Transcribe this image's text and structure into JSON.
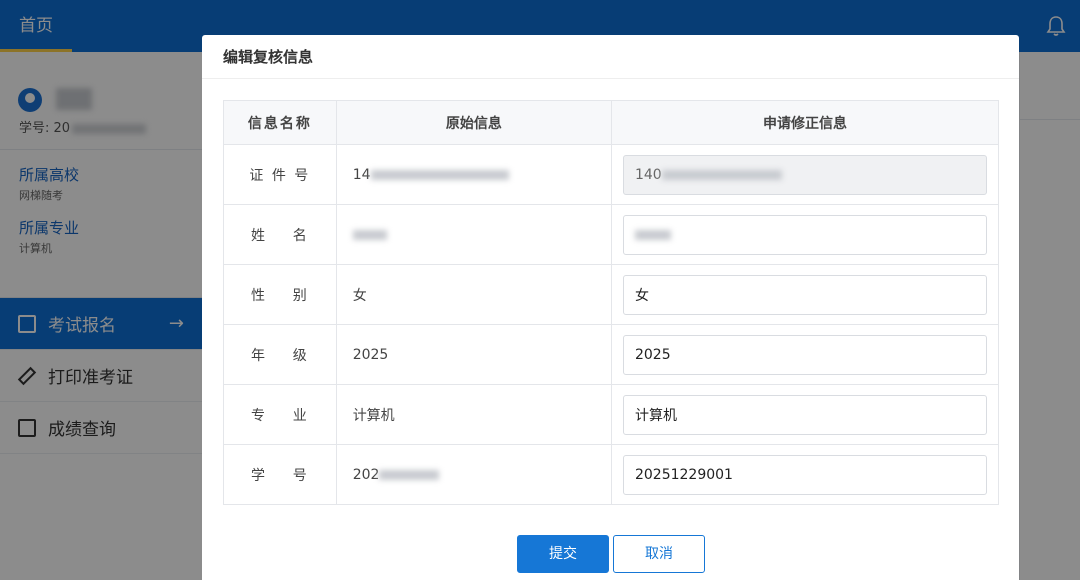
{
  "app": {
    "home_tab": "首页",
    "student_no_prefix": "学号: 20",
    "info": [
      {
        "title": "所属高校",
        "value": "网梯随考"
      },
      {
        "title": "所属专业",
        "value": "计算机"
      }
    ],
    "menu": [
      {
        "label": "考试报名",
        "active": true
      },
      {
        "label": "打印准考证",
        "active": false
      },
      {
        "label": "成绩查询",
        "active": false
      }
    ]
  },
  "dialog": {
    "title": "编辑复核信息",
    "headers": [
      "信息名称",
      "原始信息",
      "申请修正信息"
    ],
    "rows": [
      {
        "label": "证 件 号",
        "original": "14",
        "corrected": "140"
      },
      {
        "label": "姓    名",
        "original": "",
        "corrected": ""
      },
      {
        "label": "性    别",
        "original": "女",
        "corrected": "女"
      },
      {
        "label": "年    级",
        "original": "2025",
        "corrected": "2025"
      },
      {
        "label": "专    业",
        "original": "计算机",
        "corrected": "计算机"
      },
      {
        "label": "学    号",
        "original": "202",
        "corrected": "20251229001"
      }
    ],
    "submit_label": "提交",
    "cancel_label": "取消"
  },
  "colors": {
    "primary": "#0d6fd6",
    "button": "#1677d6"
  }
}
